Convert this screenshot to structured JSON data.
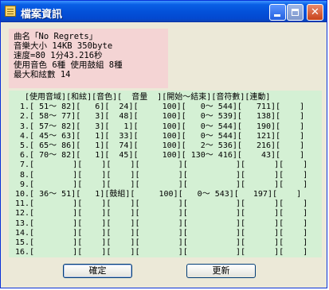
{
  "window": {
    "title": "檔案資訊"
  },
  "info": {
    "lines": [
      "曲名「No Regrets」",
      "音樂大小 14KB 350byte",
      "速度=80  1分43.216秒",
      "使用音色 6種  使用鼓組 8種",
      "最大和絃數 14"
    ]
  },
  "table": {
    "header": "  [使用音域][和絃][音色][  音量  ][開始～結束][音符數][連動]",
    "rows": [
      " 1.[ 51～ 82][   6][  24][     100][   0～ 544][   711][    ]",
      " 2.[ 58～ 77][   3][  48][     100][   0～ 539][   138][    ]",
      " 3.[ 57～ 82][   3][   1][     100][   0～ 544][   190][    ]",
      " 4.[ 45～ 63][   1][  33][     100][   0～ 544][   121][    ]",
      " 5.[ 65～ 86][   1][  74][     100][   2～ 536][   216][    ]",
      " 6.[ 70～ 82][   1][  45][     100][ 130～ 416][    43][    ]",
      " 7.[        ][    ][    ][        ][          ][      ][    ]",
      " 8.[        ][    ][    ][        ][          ][      ][    ]",
      " 9.[        ][    ][    ][        ][          ][      ][    ]",
      "10.[ 36～ 51][   1][鼓組][     100][   0～ 543][   197][    ]",
      "11.[        ][    ][    ][        ][          ][      ][    ]",
      "12.[        ][    ][    ][        ][          ][      ][    ]",
      "13.[        ][    ][    ][        ][          ][      ][    ]",
      "14.[        ][    ][    ][        ][          ][      ][    ]",
      "15.[        ][    ][    ][        ][          ][      ][    ]",
      "16.[        ][    ][    ][        ][          ][      ][    ]"
    ]
  },
  "buttons": {
    "ok": "確定",
    "refresh": "更新"
  }
}
